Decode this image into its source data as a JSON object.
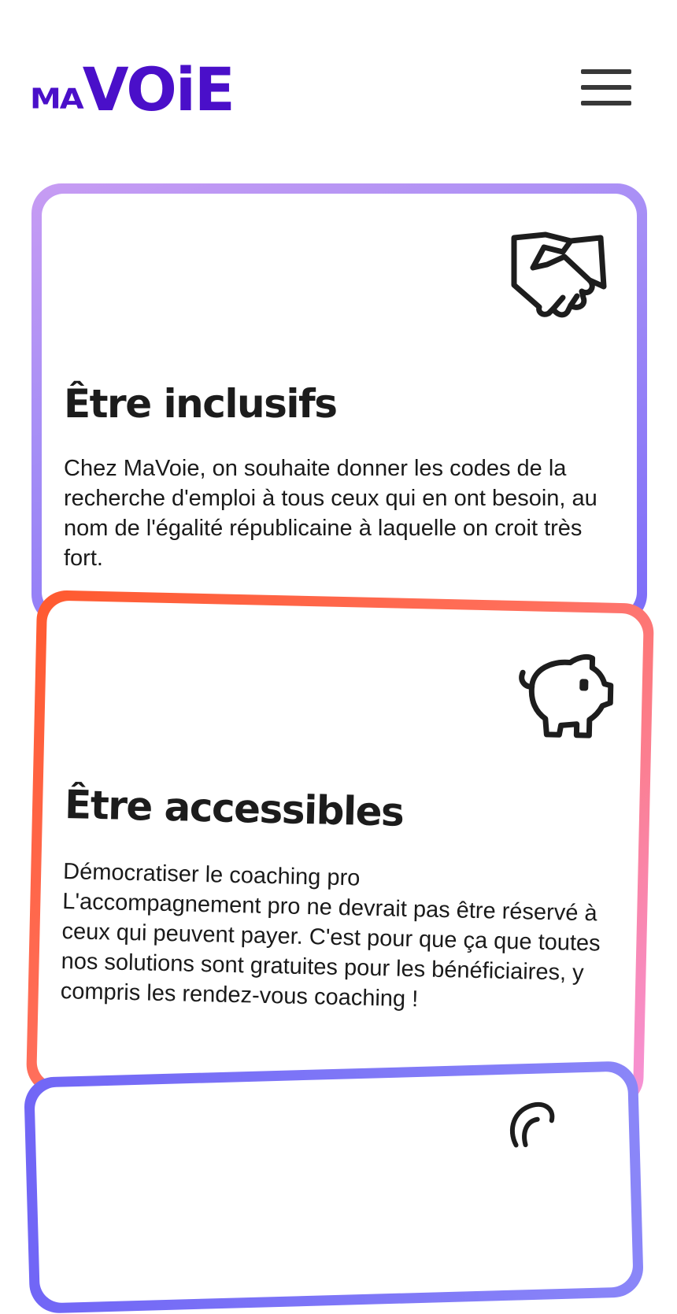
{
  "header": {
    "logo_small": "MA",
    "logo_big": "VOiE",
    "logo_color": "#4a0fc9",
    "menu_icon": "hamburger-menu-icon"
  },
  "cards": [
    {
      "icon": "handshake-icon",
      "title": "Être inclusifs",
      "text": "Chez MaVoie, on souhaite donner les codes de la recherche d'emploi à tous ceux qui en ont besoin, au nom de l'égalité républicaine à laquelle on croit très fort.",
      "border_gradient": [
        "#c79cf3",
        "#7c6cf8"
      ]
    },
    {
      "icon": "piggy-bank-icon",
      "title": "Être accessibles",
      "text": "Démocratiser le coaching pro\nL'accompagnement pro ne devrait pas être réservé à ceux qui peuvent payer. C'est pour que ça que toutes nos solutions sont gratuites pour les bénéficiaires, y compris les rendez-vous coaching !",
      "border_gradient": [
        "#ff5a2f",
        "#f693d8"
      ]
    },
    {
      "icon": "partial-icon",
      "border_gradient": [
        "#7166f6",
        "#8a86f8"
      ]
    }
  ]
}
